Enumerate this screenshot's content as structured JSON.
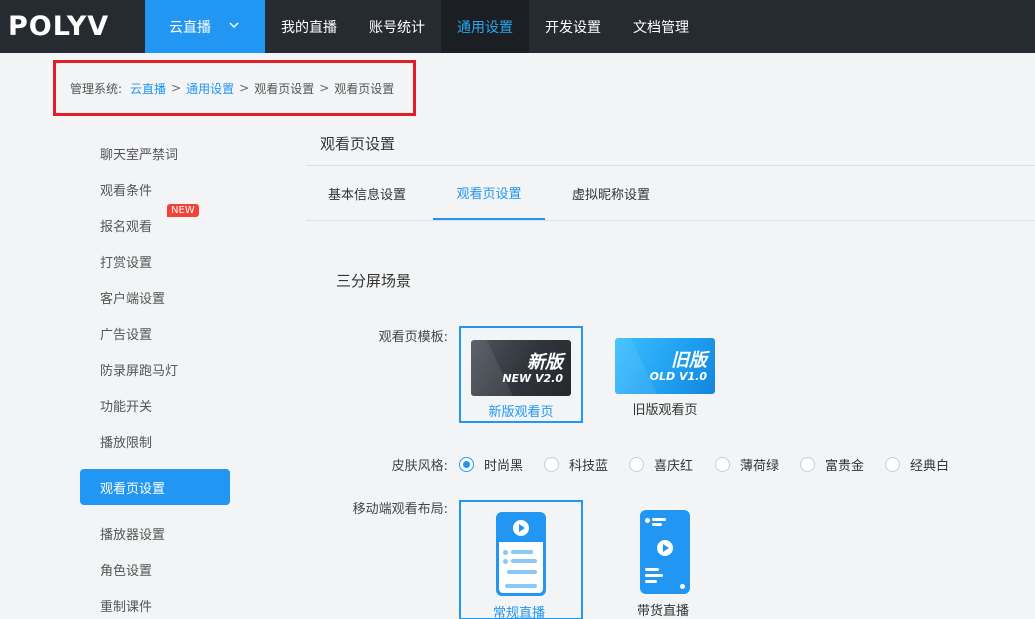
{
  "brand": {
    "logo_text": "POLYV"
  },
  "topnav": {
    "product_label": "云直播",
    "items": [
      {
        "label": "我的直播"
      },
      {
        "label": "账号统计"
      },
      {
        "label": "通用设置"
      },
      {
        "label": "开发设置"
      },
      {
        "label": "文档管理"
      }
    ],
    "active_index": 2
  },
  "breadcrumb": {
    "prefix": "管理系统:",
    "links": [
      "云直播",
      "通用设置"
    ],
    "crumbs": [
      "观看页设置",
      "观看页设置"
    ],
    "separator": ">"
  },
  "sidebar": {
    "items": [
      {
        "label": "聊天室严禁词"
      },
      {
        "label": "观看条件"
      },
      {
        "label": "报名观看"
      },
      {
        "label": "打赏设置"
      },
      {
        "label": "客户端设置"
      },
      {
        "label": "广告设置"
      },
      {
        "label": "防录屏跑马灯"
      },
      {
        "label": "功能开关"
      },
      {
        "label": "播放限制"
      },
      {
        "label": "观看页设置"
      },
      {
        "label": "播放器设置"
      },
      {
        "label": "角色设置"
      },
      {
        "label": "重制课件"
      }
    ],
    "active_index": 9,
    "new_badge": "NEW"
  },
  "main": {
    "title": "观看页设置",
    "tabs": [
      {
        "label": "基本信息设置"
      },
      {
        "label": "观看页设置"
      },
      {
        "label": "虚拟昵称设置"
      }
    ],
    "active_tab": 1,
    "section_title": "三分屏场景",
    "template": {
      "label": "观看页模板:",
      "options": [
        {
          "thumb_big": "新版",
          "thumb_small": "NEW V2.0",
          "caption": "新版观看页",
          "selected": true
        },
        {
          "thumb_big": "旧版",
          "thumb_small": "OLD V1.0",
          "caption": "旧版观看页",
          "selected": false
        }
      ]
    },
    "skin": {
      "label": "皮肤风格:",
      "options": [
        "时尚黑",
        "科技蓝",
        "喜庆红",
        "薄荷绿",
        "富贵金",
        "经典白"
      ],
      "selected_index": 0
    },
    "mobile_layout": {
      "label": "移动端观看布局:",
      "options": [
        {
          "caption": "常规直播",
          "selected": true
        },
        {
          "caption": "带货直播",
          "selected": false
        }
      ]
    }
  },
  "colors": {
    "accent": "#2196f3",
    "topbar": "#262b31",
    "highlight_border": "#e01e27",
    "badge": "#f44336"
  }
}
